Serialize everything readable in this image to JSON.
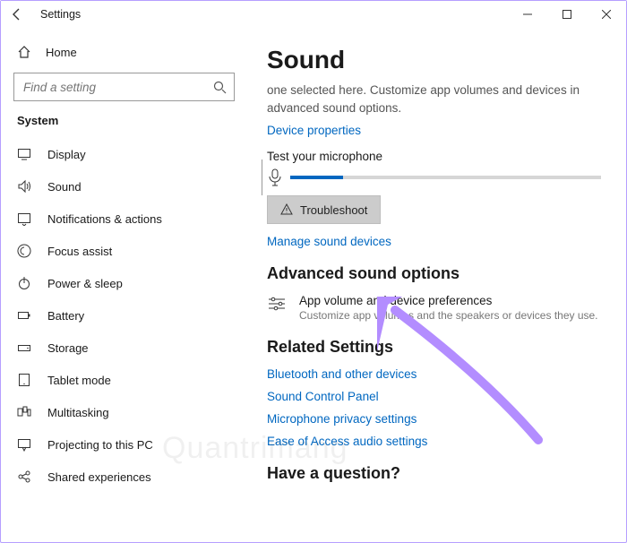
{
  "titlebar": {
    "title": "Settings"
  },
  "sidebar": {
    "home": "Home",
    "search_placeholder": "Find a setting",
    "section": "System",
    "items": [
      {
        "label": "Display"
      },
      {
        "label": "Sound"
      },
      {
        "label": "Notifications & actions"
      },
      {
        "label": "Focus assist"
      },
      {
        "label": "Power & sleep"
      },
      {
        "label": "Battery"
      },
      {
        "label": "Storage"
      },
      {
        "label": "Tablet mode"
      },
      {
        "label": "Multitasking"
      },
      {
        "label": "Projecting to this PC"
      },
      {
        "label": "Shared experiences"
      }
    ]
  },
  "main": {
    "title": "Sound",
    "desc": "one selected here. Customize app volumes and devices in advanced sound options.",
    "device_props": "Device properties",
    "test_mic": "Test your microphone",
    "mic_fill_pct": 17,
    "troubleshoot": "Troubleshoot",
    "manage_devices": "Manage sound devices",
    "advanced_title": "Advanced sound options",
    "adv_item_title": "App volume and device preferences",
    "adv_item_sub": "Customize app volumes and the speakers or devices they use.",
    "related_title": "Related Settings",
    "related_links": [
      "Bluetooth and other devices",
      "Sound Control Panel",
      "Microphone privacy settings",
      "Ease of Access audio settings"
    ],
    "question_title": "Have a question?"
  }
}
